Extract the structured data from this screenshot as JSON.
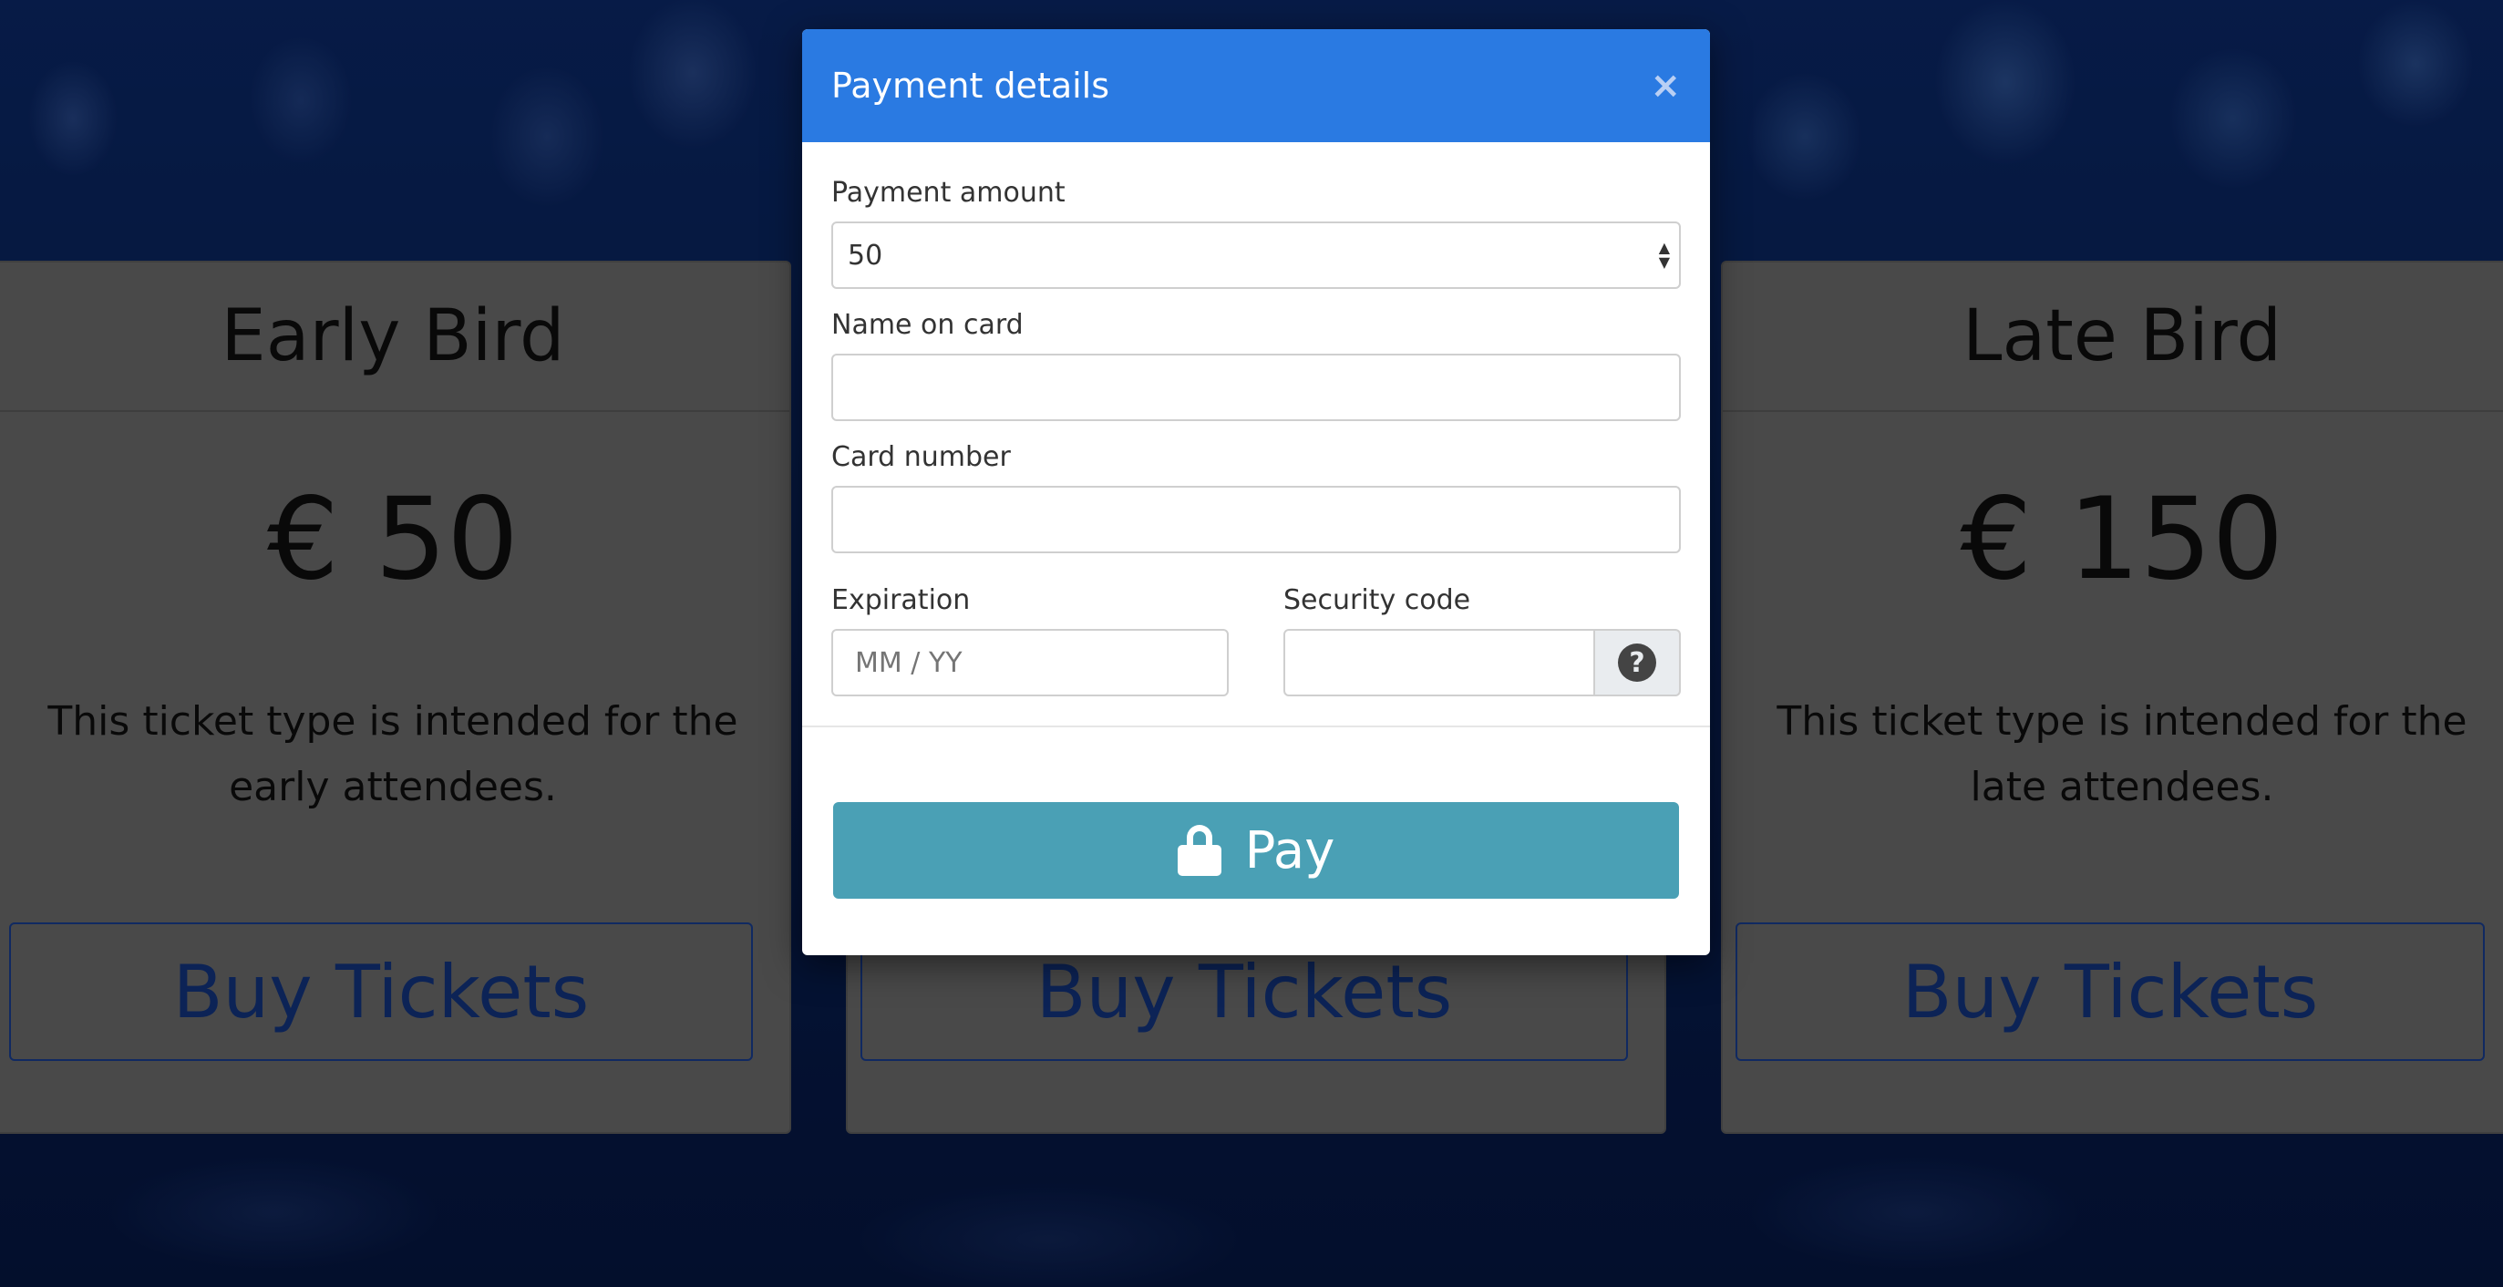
{
  "cards": [
    {
      "title": "Early Bird",
      "price": "€ 50",
      "description": "This ticket type is intended for the early attendees.",
      "button": "Buy Tickets"
    },
    {
      "title": "",
      "price": "",
      "description": "",
      "button": "Buy Tickets"
    },
    {
      "title": "Late Bird",
      "price": "€ 150",
      "description": "This ticket type is intended for the late attendees.",
      "button": "Buy Tickets"
    }
  ],
  "modal": {
    "title": "Payment details",
    "close": "×",
    "amount_label": "Payment amount",
    "amount_value": "50",
    "name_label": "Name on card",
    "name_value": "",
    "card_label": "Card number",
    "card_value": "",
    "expiration_label": "Expiration",
    "expiration_placeholder": "MM / YY",
    "security_label": "Security code",
    "security_value": "",
    "help_icon": "?",
    "pay_label": "Pay",
    "pay_icon": "lock-icon"
  },
  "colors": {
    "header": "#2a7ae2",
    "pay_button": "#4aa0b5",
    "buy_text": "#153d95"
  }
}
